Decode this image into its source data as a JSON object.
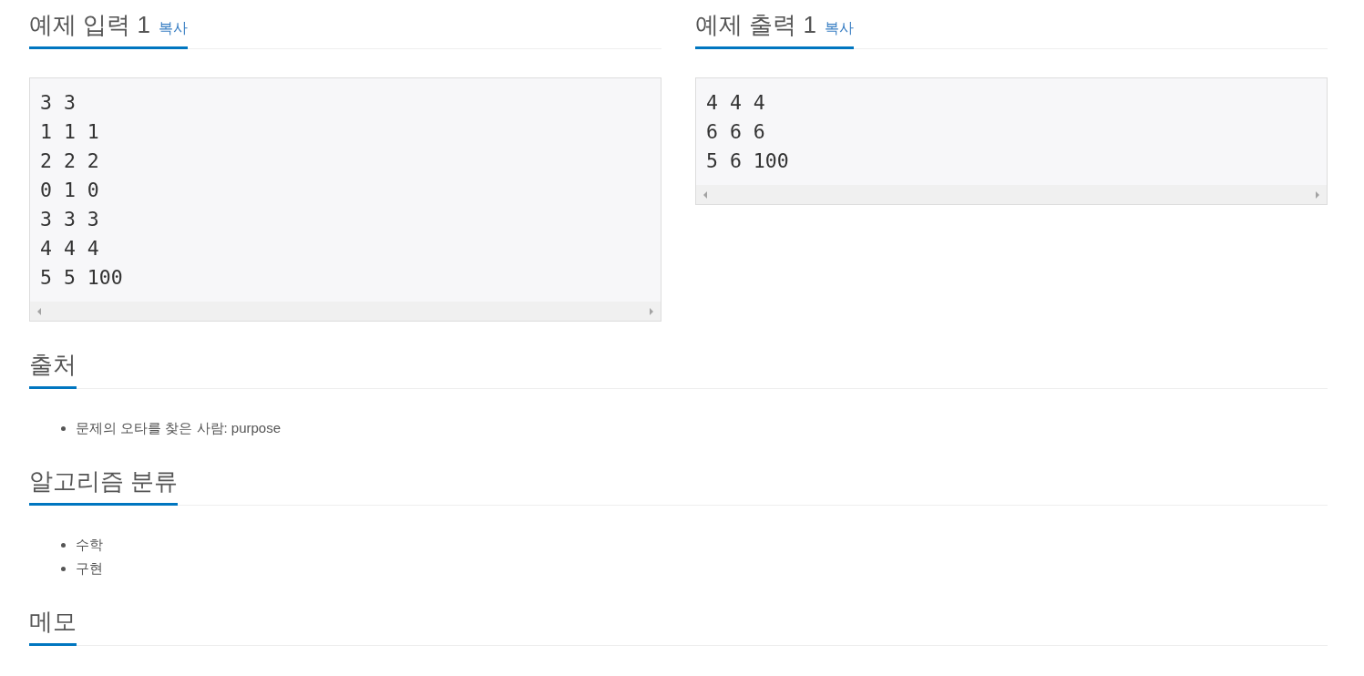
{
  "samples": [
    {
      "title": "예제 입력 1",
      "copy_link": "복사",
      "lines": [
        "3 3",
        "1 1 1",
        "2 2 2",
        "0 1 0",
        "3 3 3",
        "4 4 4",
        "5 5 100"
      ]
    },
    {
      "title": "예제 출력 1",
      "copy_link": "복사",
      "lines": [
        "4 4 4",
        "6 6 6",
        "5 6 100"
      ]
    }
  ],
  "sections": [
    {
      "title": "출처",
      "items": [
        "문제의 오타를 찾은 사람: purpose"
      ]
    },
    {
      "title": "알고리즘 분류",
      "items": [
        "수학",
        "구현"
      ]
    },
    {
      "title": "메모"
    }
  ]
}
